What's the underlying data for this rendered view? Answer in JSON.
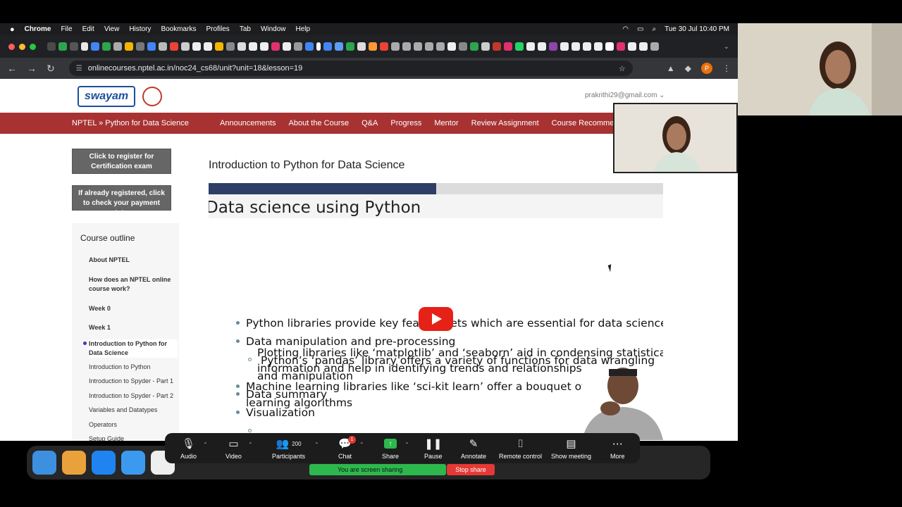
{
  "menubar": {
    "app": "Chrome",
    "items": [
      "File",
      "Edit",
      "View",
      "History",
      "Bookmarks",
      "Profiles",
      "Tab",
      "Window",
      "Help"
    ],
    "datetime": "Tue 30 Jul  10:40 PM"
  },
  "browser": {
    "url": "onlinecourses.nptel.ac.in/noc24_cs68/unit?unit=18&lesson=19",
    "profile_initial": "P"
  },
  "site": {
    "logo_text": "swayam",
    "user_email": "prakrithi29@gmail.com ⌄",
    "breadcrumb": "NPTEL  »  Python for Data Science",
    "nav": [
      "Announcements",
      "About the Course",
      "Q&A",
      "Progress",
      "Mentor",
      "Review Assignment",
      "Course Recomme"
    ],
    "register_button": "Click to register for Certification exam",
    "payment_button": "If already registered, click to check your payment status",
    "course_outline_heading": "Course outline",
    "outline": [
      {
        "label": "About NPTEL",
        "bold": true
      },
      {
        "label": "How does an NPTEL online course work?",
        "bold": true
      },
      {
        "label": "Week 0",
        "bold": true
      },
      {
        "label": "Week 1",
        "bold": true
      },
      {
        "label": "Introduction to Python for Data Science",
        "bold": true,
        "active": true
      },
      {
        "label": "Introduction to Python",
        "bold": false
      },
      {
        "label": "Introduction to Spyder - Part 1",
        "bold": false
      },
      {
        "label": "Introduction to Spyder - Part 2",
        "bold": false
      },
      {
        "label": "Variables and Datatypes",
        "bold": false
      },
      {
        "label": "Operators",
        "bold": false
      },
      {
        "label": "Setup Guide",
        "bold": false
      }
    ],
    "lesson_title": "Introduction to Python for Data Science"
  },
  "slide": {
    "title": "Data science using Python",
    "bullets": [
      "Python libraries provide key feature sets which are essential for data science",
      "Data manipulation and pre-processing",
      "Python’s ‘pandas’ library offers a variety of functions for data wrangling",
      "and manipulation",
      "Data summary",
      "Visualization",
      "Plotting libraries like ‘matplotlib’ and ‘seaborn’ aid in condensing statistical",
      "information and help in identifying trends and relationships",
      "Machine learning libraries like ‘sci-kit learn’ offer a bouquet of machi",
      "learning algorithms"
    ]
  },
  "zoom": {
    "audio": "Audio",
    "video": "Video",
    "participants": "Participants",
    "participants_count": "200",
    "chat": "Chat",
    "chat_badge": "1",
    "share": "Share",
    "pause": "Pause",
    "annotate": "Annotate",
    "remote_control": "Remote control",
    "show_meeting": "Show meeting",
    "more": "More",
    "sharing_status": "You are screen sharing",
    "stop_share": "Stop share"
  }
}
